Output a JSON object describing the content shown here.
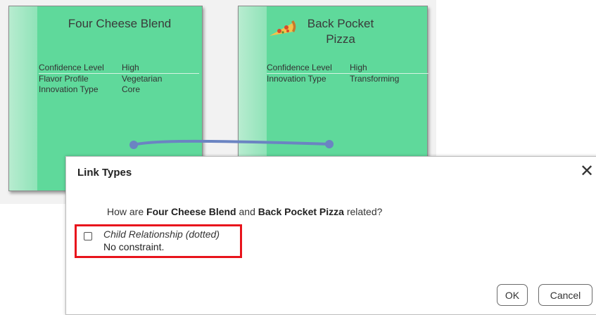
{
  "cards": [
    {
      "title": "Four Cheese Blend",
      "properties": [
        {
          "label": "Confidence Level",
          "value": "High"
        },
        {
          "label": "Flavor Profile",
          "value": "Vegetarian"
        },
        {
          "label": "Innovation Type",
          "value": "Core"
        }
      ]
    },
    {
      "title_line1": "Back Pocket",
      "title_line2": "Pizza",
      "icon": "pizza-slice-icon",
      "properties": [
        {
          "label": "Confidence Level",
          "value": "High"
        },
        {
          "label": "Innovation Type",
          "value": "Transforming"
        }
      ]
    }
  ],
  "colors": {
    "card_fill": "#5fd99b",
    "connector": "#6b84c2",
    "highlight": "#e8141c"
  },
  "dialog": {
    "title": "Link Types",
    "close_icon": "close-icon",
    "question_prefix": "How are ",
    "item_a": "Four Cheese Blend",
    "question_middle": " and ",
    "item_b": "Back Pocket Pizza",
    "question_suffix": " related?",
    "option": {
      "title": "Child Relationship (dotted)",
      "description": "No constraint.",
      "checked": false
    },
    "ok_label": "OK",
    "cancel_label": "Cancel"
  }
}
